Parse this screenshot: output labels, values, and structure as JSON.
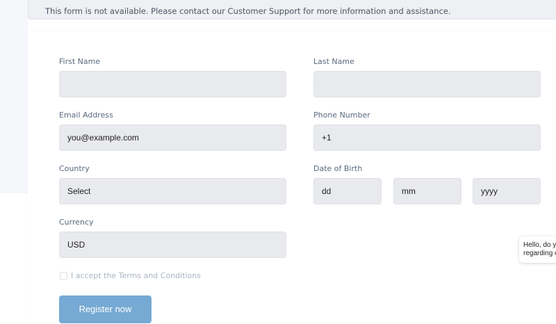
{
  "notice": "This form is not available. Please contact our Customer Support for more information and assistance.",
  "form": {
    "first_name_label": "First Name",
    "first_name_value": "",
    "last_name_label": "Last Name",
    "last_name_value": "",
    "email_label": "Email Address",
    "email_placeholder": "you@example.com",
    "phone_label": "Phone Number",
    "phone_value": "+1",
    "country_label": "Country",
    "country_value": "Select",
    "dob_label": "Date of Birth",
    "dob_day_placeholder": "dd",
    "dob_month_placeholder": "mm",
    "dob_year_placeholder": "yyyy",
    "currency_label": "Currency",
    "currency_value": "USD",
    "terms_label": "I accept the Terms and Conditions",
    "terms_checked": false,
    "register_label": "Register now"
  },
  "chat": {
    "line1": "Hello, do y",
    "line2": "regarding o"
  },
  "colors": {
    "button": "#76a9d3",
    "input_bg": "#e9eaed",
    "label": "#5a6a7e"
  }
}
